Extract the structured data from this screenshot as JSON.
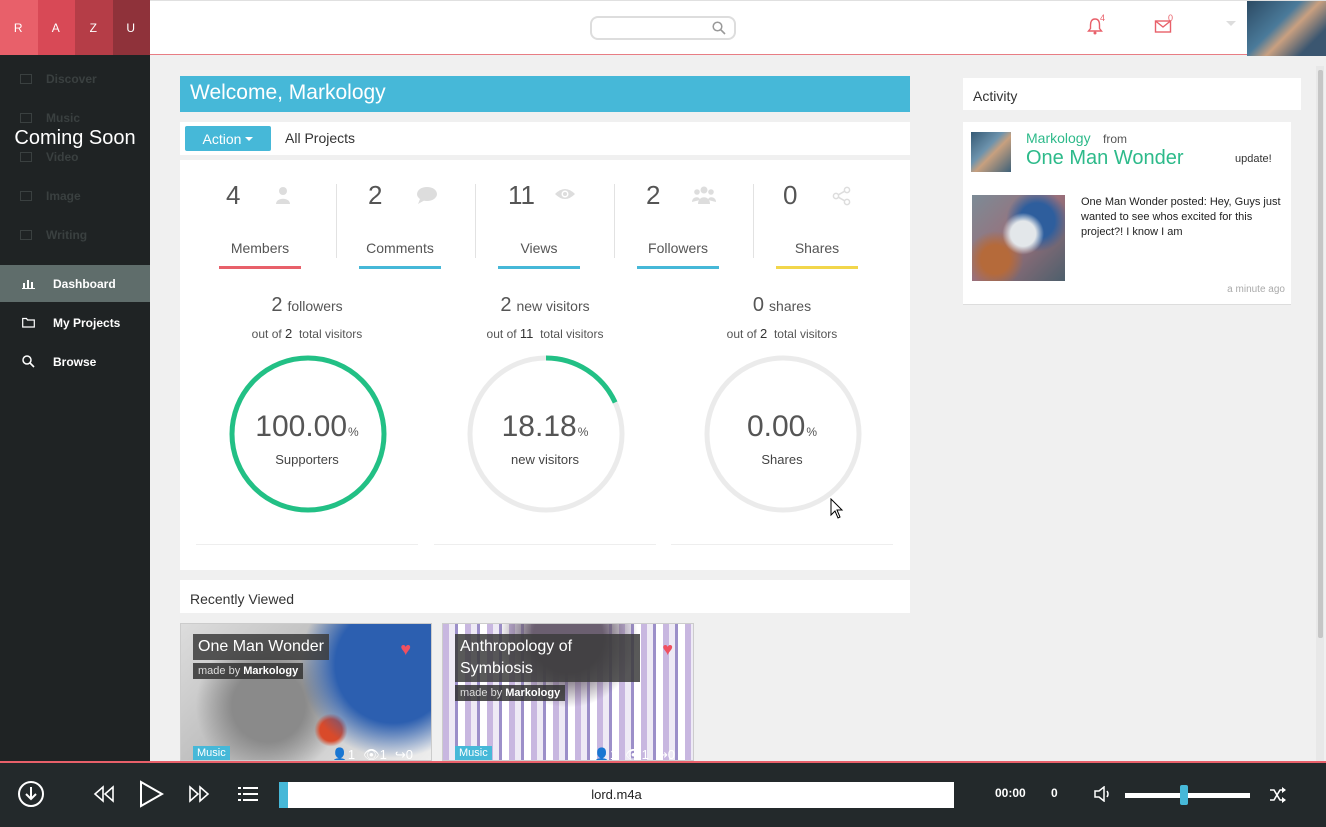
{
  "logo": [
    "R",
    "A",
    "Z",
    "U"
  ],
  "header": {
    "search_placeholder": "",
    "notification_count": "4",
    "mail_count": "0"
  },
  "sidebar": {
    "disabled_items": [
      "Discover",
      "Music",
      "Video",
      "Image",
      "Writing"
    ],
    "coming_soon": "Coming Soon",
    "nav": [
      {
        "label": "Dashboard",
        "icon": "bar-chart-icon",
        "active": true
      },
      {
        "label": "My Projects",
        "icon": "folder-icon",
        "active": false
      },
      {
        "label": "Browse",
        "icon": "search-icon",
        "active": false
      }
    ]
  },
  "welcome": "Welcome, Markology",
  "actionbar": {
    "action_label": "Action",
    "all_projects": "All Projects"
  },
  "stats": [
    {
      "value": "4",
      "label": "Members",
      "icon": "user-icon",
      "color": "#e8606a"
    },
    {
      "value": "2",
      "label": "Comments",
      "icon": "comment-icon",
      "color": "#46b8d8"
    },
    {
      "value": "11",
      "label": "Views",
      "icon": "eye-icon",
      "color": "#46b8d8"
    },
    {
      "value": "2",
      "label": "Followers",
      "icon": "users-icon",
      "color": "#46b8d8"
    },
    {
      "value": "0",
      "label": "Shares",
      "icon": "share-icon",
      "color": "#f2d64b"
    }
  ],
  "rings": [
    {
      "count": "2",
      "unit": "followers",
      "out_of_prefix": "out of",
      "total": "2",
      "total_suffix": "total visitors",
      "percent": "100.00",
      "pct_sign": "%",
      "label": "Supporters",
      "fraction": 1.0
    },
    {
      "count": "2",
      "unit": "new visitors",
      "out_of_prefix": "out of",
      "total": "11",
      "total_suffix": "total visitors",
      "percent": "18.18",
      "pct_sign": "%",
      "label": "new visitors",
      "fraction": 0.1818
    },
    {
      "count": "0",
      "unit": "shares",
      "out_of_prefix": "out of",
      "total": "2",
      "total_suffix": "total visitors",
      "percent": "0.00",
      "pct_sign": "%",
      "label": "Shares",
      "fraction": 0.0
    }
  ],
  "accent_colors": {
    "ring": "#22c085",
    "brand": "#46b8d8",
    "alert": "#e8606a"
  },
  "recent": {
    "heading": "Recently Viewed",
    "cards": [
      {
        "title": "One Man Wonder",
        "made_by": "made by",
        "author": "Markology",
        "tag": "Music",
        "members": "1",
        "views": "1",
        "shares": "0"
      },
      {
        "title": "Anthropology of Symbiosis",
        "made_by": "made by",
        "author": "Markology",
        "tag": "Music",
        "members": "1",
        "views": "1",
        "shares": "0"
      }
    ]
  },
  "activity": {
    "heading": "Activity",
    "user": "Markology",
    "from": "from",
    "project": "One Man Wonder",
    "action": "update!",
    "text": "One Man Wonder posted: Hey, Guys just wanted to see whos excited for this project?! I know I am",
    "time": "a minute ago"
  },
  "player": {
    "track": "lord.m4a",
    "time": "00:00",
    "count": "0",
    "progress_fraction": 0.013,
    "volume_fraction": 0.47
  }
}
